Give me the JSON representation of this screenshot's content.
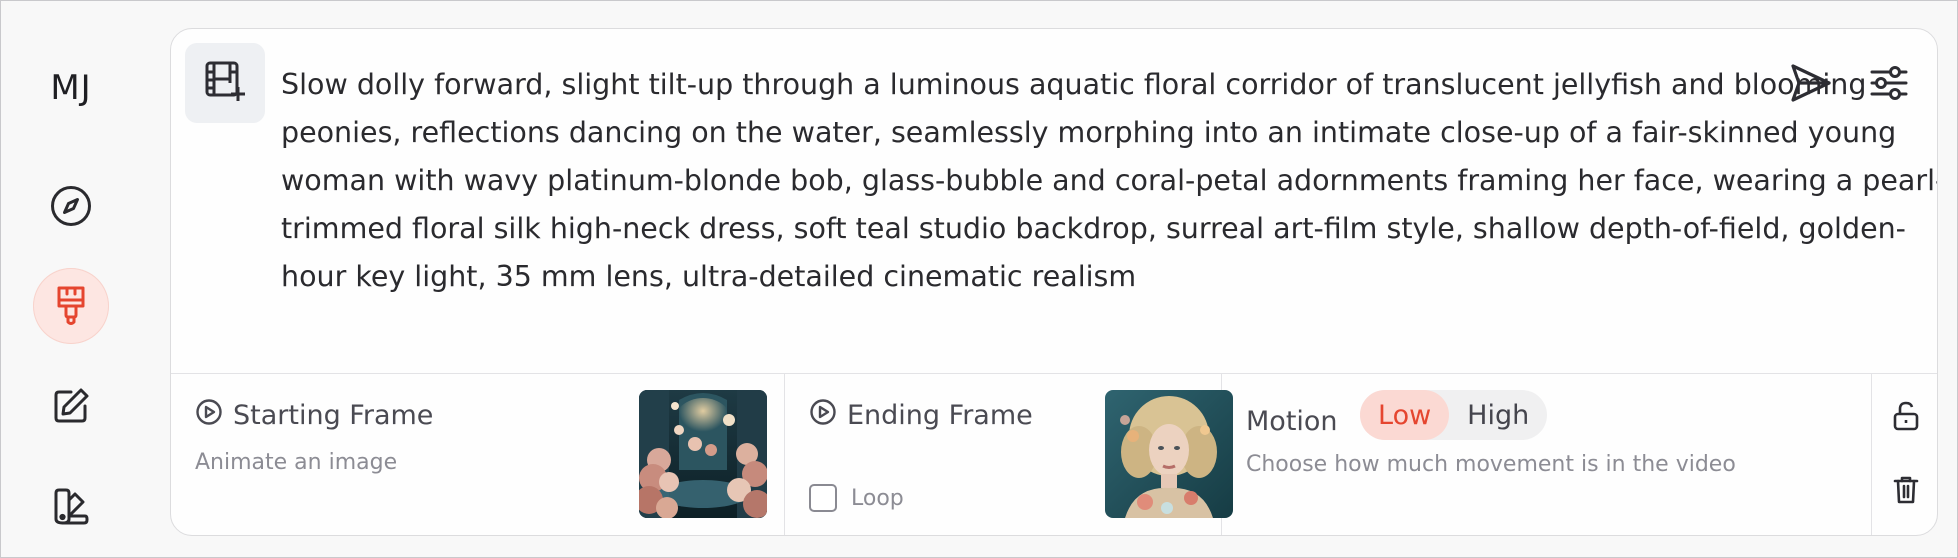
{
  "sidebar": {
    "logo": "MJ",
    "items": [
      {
        "name": "explore",
        "icon": "compass-icon"
      },
      {
        "name": "create",
        "icon": "paint-brush-icon",
        "active": true
      },
      {
        "name": "edit",
        "icon": "edit-icon"
      },
      {
        "name": "organize",
        "icon": "folder-swatch-icon"
      }
    ]
  },
  "prompt": {
    "text": "Slow dolly forward, slight tilt-up through a luminous aquatic floral corridor of translucent jellyfish and blooming peonies, reflections dancing on the water, seamlessly morphing into an intimate close-up of a fair-skinned young woman with wavy platinum-blonde bob, glass-bubble and coral-petal adornments framing her face, wearing a pearl-trimmed floral silk high-neck dress, soft teal studio backdrop, surreal art-film style, shallow depth-of-field, golden-hour key light, 35 mm lens, ultra-detailed cinematic realism"
  },
  "starting_frame": {
    "title": "Starting Frame",
    "subtitle": "Animate an image"
  },
  "ending_frame": {
    "title": "Ending Frame",
    "loop_label": "Loop",
    "loop_checked": false
  },
  "motion": {
    "title": "Motion",
    "options": [
      "Low",
      "High"
    ],
    "selected": "Low",
    "description": "Choose how much movement is in the video"
  },
  "colors": {
    "accent": "#e5452f",
    "accent_bg": "#fde6e2"
  }
}
